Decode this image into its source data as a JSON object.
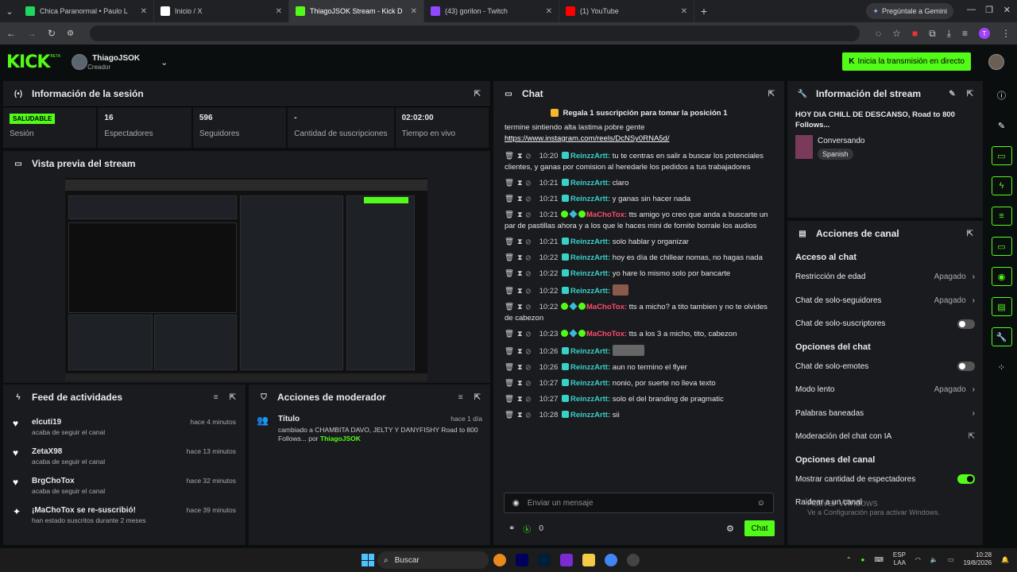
{
  "browser": {
    "tabs": [
      {
        "label": "Chica Paranormal • Paulo L",
        "color": "#1ed760"
      },
      {
        "label": "Inicio / X",
        "color": "#ffffff"
      },
      {
        "label": "ThiagoJSOK Stream - Kick D",
        "color": "#53fc18"
      },
      {
        "label": "(43) gorilon - Twitch",
        "color": "#9146ff"
      },
      {
        "label": "(1) YouTube",
        "color": "#ff0000"
      }
    ],
    "gemini": "Pregúntale a Gemini",
    "new_tab": "+"
  },
  "header": {
    "logo": "KICK",
    "beta": "BETA",
    "user": "ThiagoJSOK",
    "role": "Creador",
    "golive": "Inicia la transmisión en directo"
  },
  "session": {
    "title": "Información de la sesión",
    "status": "SALUDABLE",
    "stats": [
      {
        "value": "",
        "label": "Sesión"
      },
      {
        "value": "16",
        "label": "Espectadores"
      },
      {
        "value": "596",
        "label": "Seguidores"
      },
      {
        "value": "-",
        "label": "Cantidad de suscripciones"
      },
      {
        "value": "02:02:00",
        "label": "Tiempo en vivo"
      }
    ]
  },
  "preview": {
    "title": "Vista previa del stream"
  },
  "feed": {
    "title": "Feed de actividades",
    "items": [
      {
        "name": "elcuti19",
        "sub": "acaba de seguir el canal",
        "time": "hace 4 minutos"
      },
      {
        "name": "ZetaX98",
        "sub": "acaba de seguir el canal",
        "time": "hace 13 minutos"
      },
      {
        "name": "BrgChoTox",
        "sub": "acaba de seguir el canal",
        "time": "hace 32 minutos"
      },
      {
        "name": "¡MaChoTox se re-suscribió!",
        "sub": "han estado suscritos durante 2 meses",
        "time": "hace 39 minutos"
      }
    ]
  },
  "mod": {
    "title": "Acciones de moderador",
    "item_title": "Título",
    "item_time": "hace 1 día",
    "item_desc": "cambiado a CHAMBITA DAVO, JELTY Y DANYFISHY Road to 800 Follows... por",
    "item_user": "ThiagoJSOK"
  },
  "chat": {
    "title": "Chat",
    "pinned": "Regala 1 suscripción para tomar la posición 1",
    "top_text": "termine sintiendo alta lastima pobre gente",
    "top_link": "https://www.instagram.com/reels/DcNSy0RNA5d/",
    "messages": [
      {
        "time": "10:20",
        "user": "ReinzzArtt:",
        "text": "tu te centras en salir a buscar los potenciales clientes, y ganas por comision al heredarle los pedidos a tus trabajadores",
        "color": "#39d0c8",
        "emote": ""
      },
      {
        "time": "10:21",
        "user": "ReinzzArtt:",
        "text": "claro",
        "color": "#39d0c8",
        "emote": ""
      },
      {
        "time": "10:21",
        "user": "ReinzzArtt:",
        "text": "y ganas sin hacer nada",
        "color": "#39d0c8",
        "emote": ""
      },
      {
        "time": "10:21",
        "user": "MaChoTox:",
        "text": "tts amigo yo creo que anda a buscarte un par de pastillas ahora y a los que le haces mini de fornite borrale los audios",
        "color": "#ff4d6a",
        "emote": "",
        "badges": true
      },
      {
        "time": "10:21",
        "user": "ReinzzArtt:",
        "text": "solo hablar y organizar",
        "color": "#39d0c8",
        "emote": ""
      },
      {
        "time": "10:22",
        "user": "ReinzzArtt:",
        "text": "hoy es día de chillear nomas, no hagas nada",
        "color": "#39d0c8",
        "emote": ""
      },
      {
        "time": "10:22",
        "user": "ReinzzArtt:",
        "text": "yo hare lo mismo solo por bancarte",
        "color": "#39d0c8",
        "emote": ""
      },
      {
        "time": "10:22",
        "user": "ReinzzArtt:",
        "text": "",
        "color": "#39d0c8",
        "emote": "e1"
      },
      {
        "time": "10:22",
        "user": "MaChoTox:",
        "text": "tts a micho? a tito tambien y no te olvides de cabezon",
        "color": "#ff4d6a",
        "emote": "",
        "badges": true
      },
      {
        "time": "10:23",
        "user": "MaChoTox:",
        "text": "tts a los 3 a micho, tito, cabezon",
        "color": "#ff4d6a",
        "emote": "",
        "badges": true
      },
      {
        "time": "10:26",
        "user": "ReinzzArtt:",
        "text": "",
        "color": "#39d0c8",
        "emote": "e2"
      },
      {
        "time": "10:26",
        "user": "ReinzzArtt:",
        "text": "aun no termino el flyer",
        "color": "#39d0c8",
        "emote": ""
      },
      {
        "time": "10:27",
        "user": "ReinzzArtt:",
        "text": "nonio, por suerte no lleva texto",
        "color": "#39d0c8",
        "emote": ""
      },
      {
        "time": "10:27",
        "user": "ReinzzArtt:",
        "text": "solo el del branding de pragmatic",
        "color": "#39d0c8",
        "emote": ""
      },
      {
        "time": "10:28",
        "user": "ReinzzArtt:",
        "text": "sii",
        "color": "#39d0c8",
        "emote": ""
      }
    ],
    "placeholder": "Enviar un mensaje",
    "send": "Chat",
    "points": "0"
  },
  "stream_info": {
    "title": "Información del stream",
    "stream_title": "HOY DIA CHILL DE DESCANSO, Road to 800 Follows...",
    "category": "Conversando",
    "language": "Spanish"
  },
  "channel": {
    "title": "Acciones de canal",
    "sections": [
      {
        "heading": "Acceso al chat",
        "rows": [
          {
            "label": "Restricción de edad",
            "value": "Apagado",
            "kind": "arrow"
          },
          {
            "label": "Chat de solo-seguidores",
            "value": "Apagado",
            "kind": "arrow"
          },
          {
            "label": "Chat de solo-suscriptores",
            "value": "",
            "kind": "toggle-off"
          }
        ]
      },
      {
        "heading": "Opciones del chat",
        "rows": [
          {
            "label": "Chat de solo-emotes",
            "value": "",
            "kind": "toggle-off"
          },
          {
            "label": "Modo lento",
            "value": "Apagado",
            "kind": "arrow"
          },
          {
            "label": "Palabras baneadas",
            "value": "",
            "kind": "arrow"
          },
          {
            "label": "Moderación del chat con IA",
            "value": "",
            "kind": "ext"
          }
        ]
      },
      {
        "heading": "Opciones del canal",
        "rows": [
          {
            "label": "Mostrar cantidad de espectadores",
            "value": "",
            "kind": "toggle-on"
          },
          {
            "label": "Raidear a un canal",
            "value": "",
            "kind": "none"
          }
        ]
      }
    ]
  },
  "watermark": {
    "title": "Activar Windows",
    "sub": "Ve a Configuración para activar Windows."
  },
  "taskbar": {
    "search": "Buscar",
    "lang": "ESP",
    "lang2": "LAA",
    "time": "10:28",
    "date": "19/8/2026"
  }
}
